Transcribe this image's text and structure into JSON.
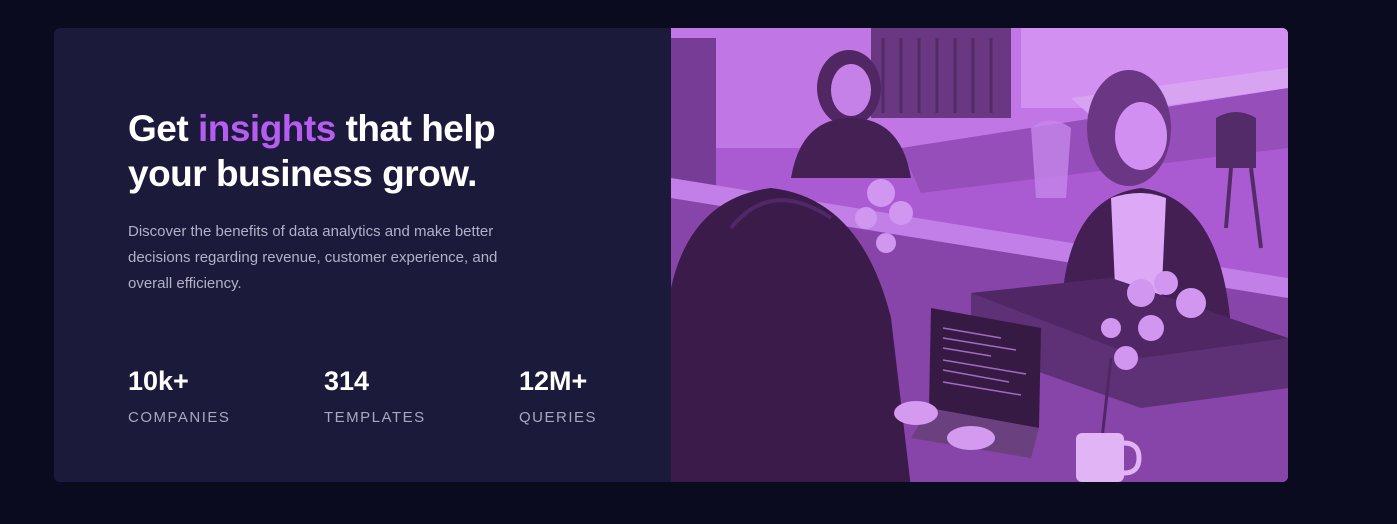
{
  "hero": {
    "headline_pre": "Get ",
    "headline_accent": "insights",
    "headline_post": " that help your business grow.",
    "description": "Discover the benefits of data analytics and make better decisions regarding revenue, customer experience, and overall efficiency."
  },
  "stats": [
    {
      "value": "10k+",
      "label": "COMPANIES"
    },
    {
      "value": "314",
      "label": "TEMPLATES"
    },
    {
      "value": "12M+",
      "label": "QUERIES"
    }
  ],
  "image": {
    "subject": "office-team-photo"
  },
  "colors": {
    "page_background": "#0b0b1f",
    "card_background": "#1b1a3a",
    "accent": "#b75cf0",
    "photo_tint": "#b565e0"
  }
}
